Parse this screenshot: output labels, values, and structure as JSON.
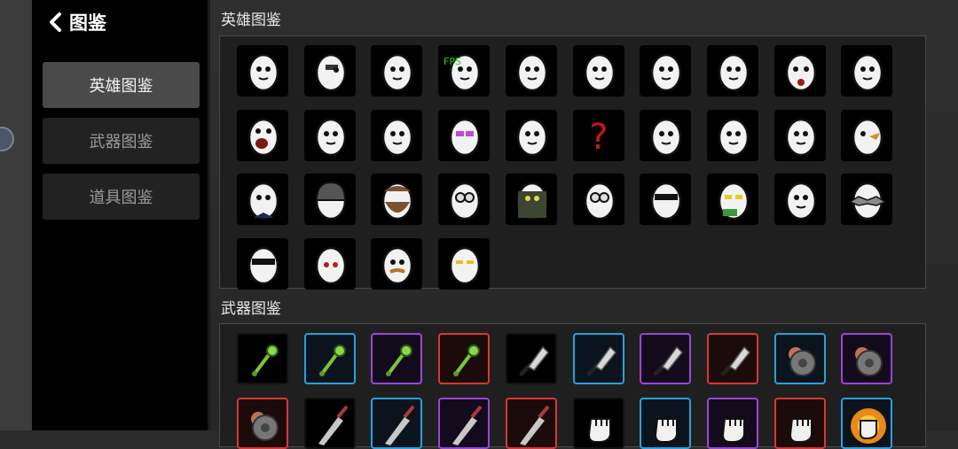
{
  "nav": {
    "back_label": "图鉴"
  },
  "tabs": [
    {
      "label": "英雄图鉴",
      "active": true
    },
    {
      "label": "武器图鉴",
      "active": false
    },
    {
      "label": "道具图鉴",
      "active": false
    }
  ],
  "sections": {
    "heroes_title": "英雄图鉴",
    "weapons_title": "武器图鉴"
  },
  "heroes": [
    {
      "icon": "hero-plain-icon"
    },
    {
      "icon": "hero-eyepatch-icon"
    },
    {
      "icon": "hero-squint-icon"
    },
    {
      "icon": "hero-fps-icon",
      "tag": "FPS"
    },
    {
      "icon": "hero-robot-jaw-icon"
    },
    {
      "icon": "hero-cute-icon"
    },
    {
      "icon": "hero-worried-icon"
    },
    {
      "icon": "hero-side-icon"
    },
    {
      "icon": "hero-bloody-icon"
    },
    {
      "icon": "hero-dirty-icon"
    },
    {
      "icon": "hero-screaming-icon"
    },
    {
      "icon": "hero-bird-icon"
    },
    {
      "icon": "hero-sad-icon"
    },
    {
      "icon": "hero-pink-glasses-icon"
    },
    {
      "icon": "hero-scared-icon"
    },
    {
      "icon": "hero-mystery-icon",
      "tag": "?"
    },
    {
      "icon": "hero-angry-icon"
    },
    {
      "icon": "hero-panda-icon"
    },
    {
      "icon": "hero-ghost-icon"
    },
    {
      "icon": "hero-orange-beak-icon"
    },
    {
      "icon": "hero-suit-icon"
    },
    {
      "icon": "hero-helmet-icon"
    },
    {
      "icon": "hero-bearded-icon"
    },
    {
      "icon": "hero-mask-glasses-icon"
    },
    {
      "icon": "hero-ninja-icon"
    },
    {
      "icon": "hero-goggles-icon"
    },
    {
      "icon": "hero-sunglasses-icon"
    },
    {
      "icon": "hero-cash-icon"
    },
    {
      "icon": "hero-calm-icon"
    },
    {
      "icon": "hero-spiked-icon"
    },
    {
      "icon": "hero-visor-icon"
    },
    {
      "icon": "hero-red-eyes-icon"
    },
    {
      "icon": "hero-mustache-icon"
    },
    {
      "icon": "hero-yellow-eyes-icon"
    }
  ],
  "weapons": [
    {
      "icon": "weapon-mace-icon",
      "rarity": "black"
    },
    {
      "icon": "weapon-mace-icon",
      "rarity": "blue"
    },
    {
      "icon": "weapon-mace-icon",
      "rarity": "purple"
    },
    {
      "icon": "weapon-mace-icon",
      "rarity": "red"
    },
    {
      "icon": "weapon-cleaver-icon",
      "rarity": "black"
    },
    {
      "icon": "weapon-cleaver-icon",
      "rarity": "blue"
    },
    {
      "icon": "weapon-cleaver-icon",
      "rarity": "purple"
    },
    {
      "icon": "weapon-cleaver-icon",
      "rarity": "red"
    },
    {
      "icon": "weapon-saw-icon",
      "rarity": "blue"
    },
    {
      "icon": "weapon-saw-icon",
      "rarity": "purple"
    },
    {
      "icon": "weapon-saw-icon",
      "rarity": "red"
    },
    {
      "icon": "weapon-blade-icon",
      "rarity": "black"
    },
    {
      "icon": "weapon-blade-icon",
      "rarity": "blue"
    },
    {
      "icon": "weapon-blade-icon",
      "rarity": "purple"
    },
    {
      "icon": "weapon-blade-icon",
      "rarity": "red"
    },
    {
      "icon": "weapon-fist-icon",
      "rarity": "black"
    },
    {
      "icon": "weapon-fist-icon",
      "rarity": "blue"
    },
    {
      "icon": "weapon-fist-icon",
      "rarity": "purple"
    },
    {
      "icon": "weapon-fist-icon",
      "rarity": "red"
    },
    {
      "icon": "weapon-flame-fist-icon",
      "rarity": "blue"
    }
  ]
}
